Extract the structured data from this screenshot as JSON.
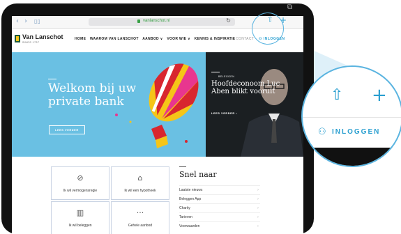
{
  "browser": {
    "url": "vanlanschot.nl",
    "back_icon": "chevron-left-icon",
    "forward_icon": "chevron-right-icon",
    "bookmarks_icon": "book-icon",
    "reload_icon": "reload-icon",
    "share_icon": "share-icon",
    "add_icon": "plus-icon",
    "tabs_icon": "tabs-icon"
  },
  "header": {
    "logo_name": "Van Lanschot",
    "logo_sub": "SINDS 1737",
    "menu": [
      "HOME",
      "WAAROM VAN LANSCHOT",
      "AANBOD ∨",
      "VOOR WIE ∨",
      "KENNIS & INSPIRATIE"
    ],
    "contact": "CONTACT",
    "login": "INLOGGEN"
  },
  "hero": {
    "left_title": "Welkom bij uw private bank",
    "left_button": "LEES VERDER",
    "right_tag": "BELEGGEN",
    "right_title": "Hoofdeconoom Luc Aben blikt vooruit",
    "right_button": "LEES VERDER  ›"
  },
  "cards": [
    {
      "label": "Ik wil vermogensregie",
      "icon": "compass-icon"
    },
    {
      "label": "Ik wil een hypotheek",
      "icon": "house-icon"
    },
    {
      "label": "Ik wil beleggen",
      "icon": "chart-icon"
    },
    {
      "label": "Gehele aanbod",
      "icon": "dots-icon"
    }
  ],
  "snel": {
    "title": "Snel naar",
    "items": [
      "Laatste nieuws",
      "Beleggen App",
      "Charity",
      "Tarieven",
      "Voorwaarden"
    ]
  },
  "zoom": {
    "login": "INLOGGEN"
  },
  "colors": {
    "accent": "#2a9fd0",
    "hero_blue": "#6ac0e3",
    "logo_green": "#1f5a3a"
  }
}
